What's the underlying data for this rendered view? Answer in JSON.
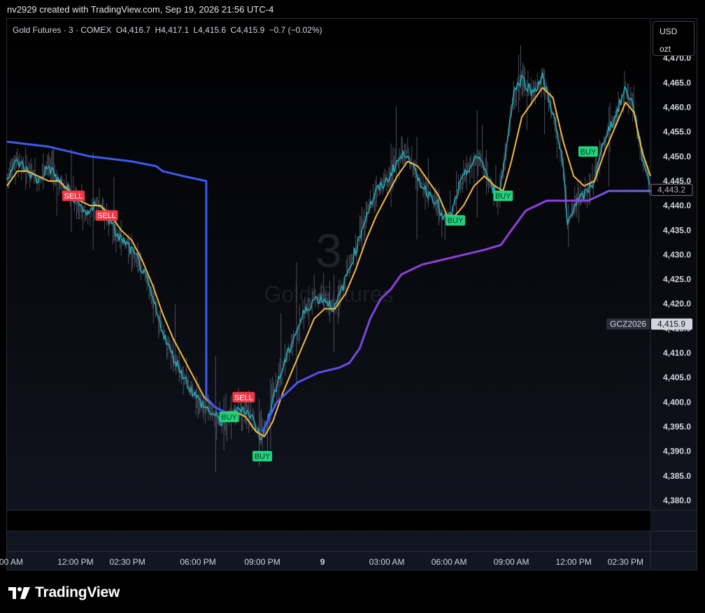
{
  "caption": "nv2929 created with TradingView.com, Sep 19, 2026 21:56 UTC-4",
  "legend": {
    "symbol": "Gold Futures · 3 · COMEX",
    "open": "O4,416.7",
    "high": "H4,417.1",
    "low": "L4,415.6",
    "close": "C4,415.9",
    "change": "−0.7 (−0.02%)"
  },
  "unit": {
    "currency": "USD",
    "measure": "ozt"
  },
  "watermark": {
    "interval": "3",
    "name": "Gold Futures"
  },
  "badges": {
    "contract": "GCZ2026",
    "last_price": "4,415.9",
    "vwap_price": "4,443.2"
  },
  "footer": {
    "brand": "TradingView"
  },
  "colors": {
    "price": "#22a6b3",
    "ema": "#f5b942",
    "vwap_blue": "#3d5af1",
    "vwap_purple": "#8e3fd6",
    "sell": "#f23645",
    "buy": "#22d17c"
  },
  "icons": {
    "logo": "tradingview-logo-icon"
  },
  "chart_data": {
    "type": "line",
    "ylim": [
      4378,
      4478
    ],
    "y_ticks": [
      "4,380.0",
      "4,385.0",
      "4,390.0",
      "4,395.0",
      "4,400.0",
      "4,405.0",
      "4,410.0",
      "4,415.0",
      "4,420.0",
      "4,425.0",
      "4,430.0",
      "4,435.0",
      "4,440.0",
      "4,445.0",
      "4,450.0",
      "4,455.0",
      "4,460.0",
      "4,465.0",
      "4,470.0"
    ],
    "y_tick_values": [
      4380,
      4385,
      4390,
      4395,
      4400,
      4405,
      4410,
      4415,
      4420,
      4425,
      4430,
      4435,
      4440,
      4445,
      4450,
      4455,
      4460,
      4465,
      4470
    ],
    "x_ticks": [
      {
        "label": "00 AM",
        "hour": -0.8
      },
      {
        "label": "12:00 PM",
        "hour": 2.3
      },
      {
        "label": "02:30 PM",
        "hour": 4.8
      },
      {
        "label": "06:00 PM",
        "hour": 8.2
      },
      {
        "label": "09:00 PM",
        "hour": 11.3
      },
      {
        "label": "9",
        "hour": 14.2,
        "bold": true
      },
      {
        "label": "03:00 AM",
        "hour": 17.3
      },
      {
        "label": "06:00 AM",
        "hour": 20.3
      },
      {
        "label": "09:00 AM",
        "hour": 23.3
      },
      {
        "label": "12:00 PM",
        "hour": 26.3
      },
      {
        "label": "02:30 PM",
        "hour": 28.8
      }
    ],
    "x_range_hours": [
      -1.0,
      30.0
    ],
    "series": [
      {
        "role": "price",
        "points": [
          [
            -1.0,
            4446
          ],
          [
            -0.5,
            4449
          ],
          [
            0.0,
            4447
          ],
          [
            0.5,
            4445
          ],
          [
            1.0,
            4448
          ],
          [
            1.5,
            4445
          ],
          [
            2.0,
            4443
          ],
          [
            2.5,
            4440
          ],
          [
            3.0,
            4438
          ],
          [
            3.3,
            4441
          ],
          [
            3.8,
            4438
          ],
          [
            4.3,
            4434
          ],
          [
            4.8,
            4432
          ],
          [
            5.3,
            4429
          ],
          [
            5.8,
            4424
          ],
          [
            6.3,
            4417
          ],
          [
            6.8,
            4411
          ],
          [
            7.3,
            4407
          ],
          [
            7.8,
            4403
          ],
          [
            8.3,
            4400
          ],
          [
            8.8,
            4398
          ],
          [
            9.3,
            4396
          ],
          [
            9.8,
            4397
          ],
          [
            10.3,
            4399
          ],
          [
            10.8,
            4397
          ],
          [
            11.2,
            4393
          ],
          [
            11.5,
            4395
          ],
          [
            11.8,
            4401
          ],
          [
            12.3,
            4407
          ],
          [
            12.8,
            4413
          ],
          [
            13.3,
            4418
          ],
          [
            13.8,
            4421
          ],
          [
            14.3,
            4421
          ],
          [
            14.8,
            4419
          ],
          [
            15.3,
            4425
          ],
          [
            15.8,
            4431
          ],
          [
            16.3,
            4438
          ],
          [
            16.8,
            4443
          ],
          [
            17.3,
            4445
          ],
          [
            17.8,
            4449
          ],
          [
            18.3,
            4451
          ],
          [
            18.7,
            4446
          ],
          [
            19.2,
            4443
          ],
          [
            19.7,
            4441
          ],
          [
            20.0,
            4437
          ],
          [
            20.4,
            4438
          ],
          [
            20.8,
            4444
          ],
          [
            21.3,
            4448
          ],
          [
            21.8,
            4450
          ],
          [
            22.3,
            4444
          ],
          [
            22.7,
            4442
          ],
          [
            23.0,
            4450
          ],
          [
            23.4,
            4463
          ],
          [
            23.8,
            4466
          ],
          [
            24.3,
            4463
          ],
          [
            24.8,
            4466
          ],
          [
            25.3,
            4459
          ],
          [
            25.8,
            4448
          ],
          [
            26.0,
            4436
          ],
          [
            26.3,
            4440
          ],
          [
            26.8,
            4442
          ],
          [
            27.3,
            4445
          ],
          [
            27.8,
            4454
          ],
          [
            28.3,
            4458
          ],
          [
            28.8,
            4464
          ],
          [
            29.2,
            4460
          ],
          [
            29.6,
            4450
          ],
          [
            30.0,
            4444
          ]
        ]
      },
      {
        "role": "ema",
        "points": [
          [
            -1.0,
            4444
          ],
          [
            -0.5,
            4447
          ],
          [
            0.0,
            4447
          ],
          [
            0.5,
            4446
          ],
          [
            1.0,
            4445
          ],
          [
            1.5,
            4445
          ],
          [
            2.0,
            4443
          ],
          [
            2.5,
            4441
          ],
          [
            3.0,
            4440
          ],
          [
            3.5,
            4440
          ],
          [
            4.0,
            4438
          ],
          [
            4.5,
            4435
          ],
          [
            5.0,
            4433
          ],
          [
            5.5,
            4429
          ],
          [
            6.0,
            4424
          ],
          [
            6.5,
            4418
          ],
          [
            7.0,
            4413
          ],
          [
            7.5,
            4409
          ],
          [
            8.0,
            4405
          ],
          [
            8.5,
            4401
          ],
          [
            9.0,
            4399
          ],
          [
            9.5,
            4398
          ],
          [
            10.0,
            4398
          ],
          [
            10.5,
            4397
          ],
          [
            11.0,
            4394
          ],
          [
            11.4,
            4393
          ],
          [
            11.8,
            4396
          ],
          [
            12.3,
            4402
          ],
          [
            12.8,
            4407
          ],
          [
            13.3,
            4412
          ],
          [
            13.8,
            4417
          ],
          [
            14.3,
            4419
          ],
          [
            14.8,
            4419
          ],
          [
            15.3,
            4422
          ],
          [
            15.8,
            4427
          ],
          [
            16.3,
            4433
          ],
          [
            16.8,
            4438
          ],
          [
            17.3,
            4442
          ],
          [
            17.8,
            4446
          ],
          [
            18.3,
            4449
          ],
          [
            18.8,
            4448
          ],
          [
            19.3,
            4445
          ],
          [
            19.8,
            4442
          ],
          [
            20.2,
            4438
          ],
          [
            20.6,
            4438
          ],
          [
            21.0,
            4440
          ],
          [
            21.5,
            4444
          ],
          [
            22.0,
            4446
          ],
          [
            22.5,
            4444
          ],
          [
            22.9,
            4443
          ],
          [
            23.3,
            4449
          ],
          [
            23.8,
            4458
          ],
          [
            24.3,
            4461
          ],
          [
            24.8,
            4464
          ],
          [
            25.3,
            4462
          ],
          [
            25.8,
            4453
          ],
          [
            26.3,
            4446
          ],
          [
            26.8,
            4444
          ],
          [
            27.3,
            4445
          ],
          [
            27.8,
            4451
          ],
          [
            28.3,
            4456
          ],
          [
            28.8,
            4461
          ],
          [
            29.2,
            4459
          ],
          [
            29.6,
            4451
          ],
          [
            30.0,
            4446
          ]
        ]
      },
      {
        "role": "vwap-prev-session",
        "points": [
          [
            -1.0,
            4453
          ],
          [
            1.0,
            4452
          ],
          [
            3.0,
            4450
          ],
          [
            5.0,
            4449
          ],
          [
            6.2,
            4448
          ],
          [
            6.5,
            4447
          ],
          [
            7.5,
            4446
          ],
          [
            8.6,
            4445
          ],
          [
            8.6,
            4401
          ],
          [
            9.0,
            4399
          ],
          [
            9.5,
            4398
          ],
          [
            10.0,
            4397
          ]
        ]
      },
      {
        "role": "vwap-session",
        "points": [
          [
            11.3,
            4394
          ],
          [
            12.0,
            4400
          ],
          [
            13.0,
            4404
          ],
          [
            14.0,
            4406
          ],
          [
            15.0,
            4407
          ],
          [
            15.5,
            4408
          ],
          [
            16.0,
            4411
          ],
          [
            16.5,
            4417
          ],
          [
            17.0,
            4421
          ],
          [
            17.5,
            4423
          ],
          [
            18.0,
            4426
          ],
          [
            19.0,
            4428
          ],
          [
            20.0,
            4429
          ],
          [
            21.0,
            4430
          ],
          [
            22.0,
            4431
          ],
          [
            22.8,
            4432
          ],
          [
            23.3,
            4435
          ],
          [
            24.0,
            4439
          ],
          [
            25.0,
            4441
          ],
          [
            26.0,
            4441
          ],
          [
            27.0,
            4441
          ],
          [
            28.0,
            4443
          ],
          [
            29.0,
            4443
          ],
          [
            30.0,
            4443
          ]
        ]
      }
    ],
    "signals": [
      {
        "label": "SELL",
        "kind": "sell",
        "hour": 2.2,
        "price": 4442
      },
      {
        "label": "SELL",
        "kind": "sell",
        "hour": 3.8,
        "price": 4438
      },
      {
        "label": "SELL",
        "kind": "sell",
        "hour": 10.4,
        "price": 4401
      },
      {
        "label": "BUY",
        "kind": "buy",
        "hour": 9.7,
        "price": 4397
      },
      {
        "label": "BUY",
        "kind": "buy",
        "hour": 11.3,
        "price": 4389
      },
      {
        "label": "BUY",
        "kind": "buy",
        "hour": 20.6,
        "price": 4437
      },
      {
        "label": "BUY",
        "kind": "buy",
        "hour": 22.9,
        "price": 4442
      },
      {
        "label": "BUY",
        "kind": "buy",
        "hour": 27.0,
        "price": 4451
      }
    ]
  }
}
